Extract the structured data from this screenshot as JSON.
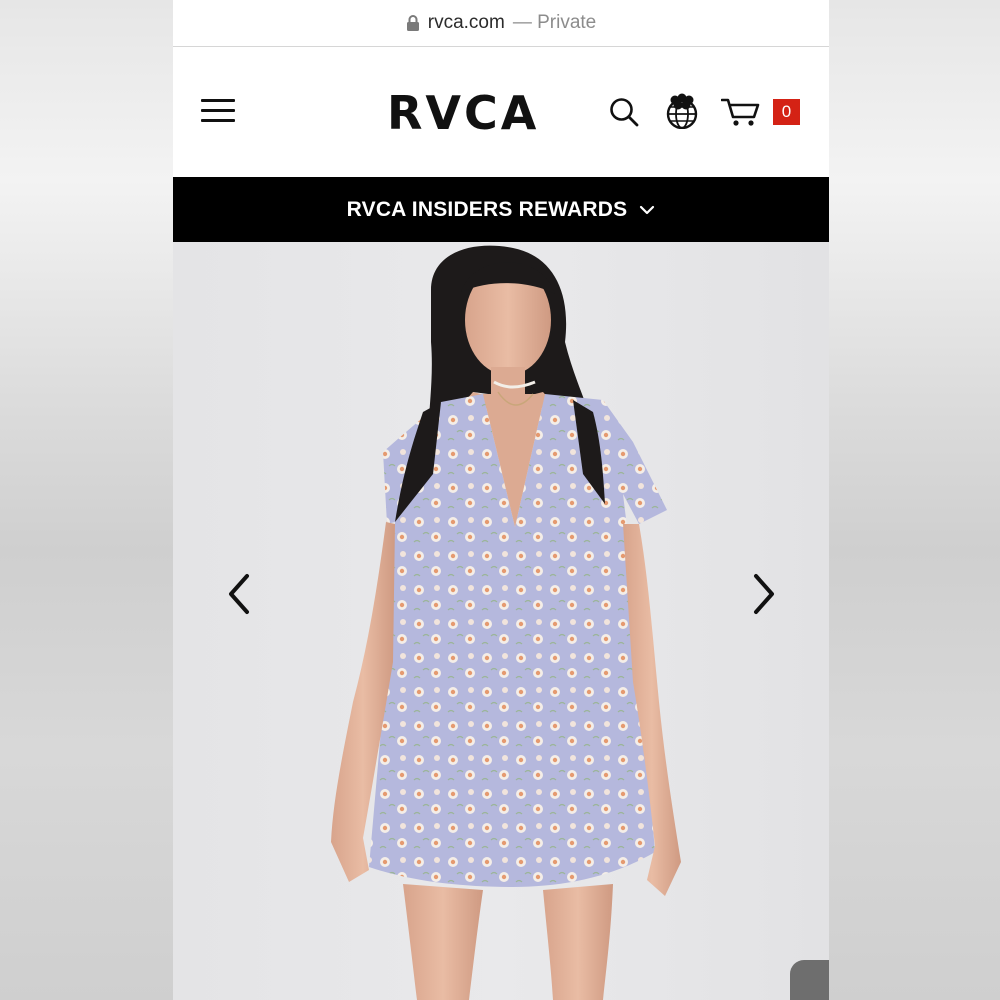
{
  "browser": {
    "url_domain": "rvca.com",
    "url_suffix": "— Private"
  },
  "header": {
    "logo": "RVCA",
    "cart_count": "0",
    "icons": [
      "menu-icon",
      "search-icon",
      "globe-icon",
      "cart-icon"
    ]
  },
  "promo": {
    "label": "RVCA INSIDERS REWARDS",
    "icon": "chevron-down-icon"
  },
  "gallery": {
    "icons": [
      "chevron-left-icon",
      "chevron-right-icon"
    ]
  },
  "colors": {
    "promo_background": "#000000",
    "cart_badge": "#d42215",
    "dress": "#b4b6dc",
    "flower": "#e9a882"
  }
}
